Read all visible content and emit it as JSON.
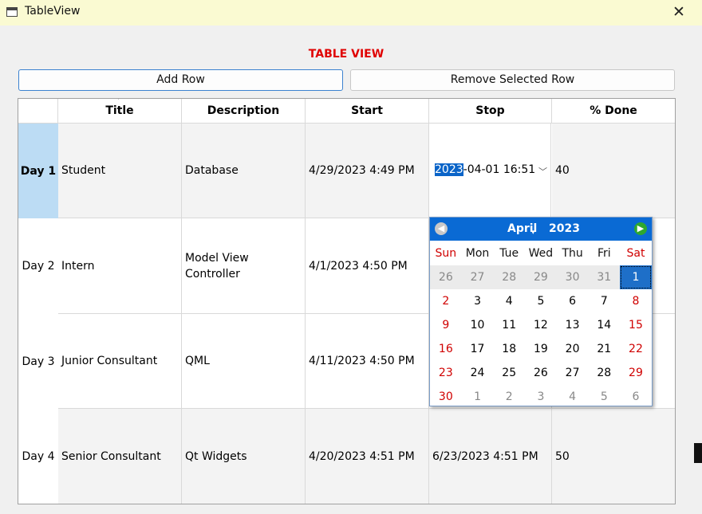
{
  "window": {
    "title": "TableView",
    "close_icon": "close-icon"
  },
  "heading": "TABLE VIEW",
  "toolbar": {
    "add_row": "Add Row",
    "remove_row": "Remove Selected Row"
  },
  "table": {
    "columns": [
      "Title",
      "Description",
      "Start",
      "Stop",
      "% Done"
    ],
    "rows": [
      {
        "header": "Day 1",
        "title": "Student",
        "description": "Database",
        "start": "4/29/2023 4:49 PM",
        "stop": "",
        "done": "40"
      },
      {
        "header": "Day 2",
        "title": "Intern",
        "description": "Model View Controller",
        "start": "4/1/2023 4:50 PM",
        "stop": "",
        "done": ""
      },
      {
        "header": "Day 3",
        "title": "Junior Consultant",
        "description": "QML",
        "start": "4/11/2023 4:50 PM",
        "stop": "",
        "done": ""
      },
      {
        "header": "Day 4",
        "title": "Senior Consultant",
        "description": "Qt Widgets",
        "start": "4/20/2023 4:51 PM",
        "stop": "6/23/2023 4:51 PM",
        "done": "50"
      }
    ]
  },
  "editor": {
    "year_selected": "2023",
    "rest": "-04-01 16:51",
    "dropdown_icon": "chevron-down-icon"
  },
  "calendar": {
    "month": "April",
    "year": "2023",
    "weekdays": [
      "Sun",
      "Mon",
      "Tue",
      "Wed",
      "Thu",
      "Fri",
      "Sat"
    ],
    "weeks": [
      [
        "26",
        "27",
        "28",
        "29",
        "30",
        "31",
        "1"
      ],
      [
        "2",
        "3",
        "4",
        "5",
        "6",
        "7",
        "8"
      ],
      [
        "9",
        "10",
        "11",
        "12",
        "13",
        "14",
        "15"
      ],
      [
        "16",
        "17",
        "18",
        "19",
        "20",
        "21",
        "22"
      ],
      [
        "23",
        "24",
        "25",
        "26",
        "27",
        "28",
        "29"
      ],
      [
        "30",
        "1",
        "2",
        "3",
        "4",
        "5",
        "6"
      ]
    ],
    "selected_day": "1",
    "prev_icon": "arrow-left-icon",
    "next_icon": "arrow-right-icon"
  }
}
